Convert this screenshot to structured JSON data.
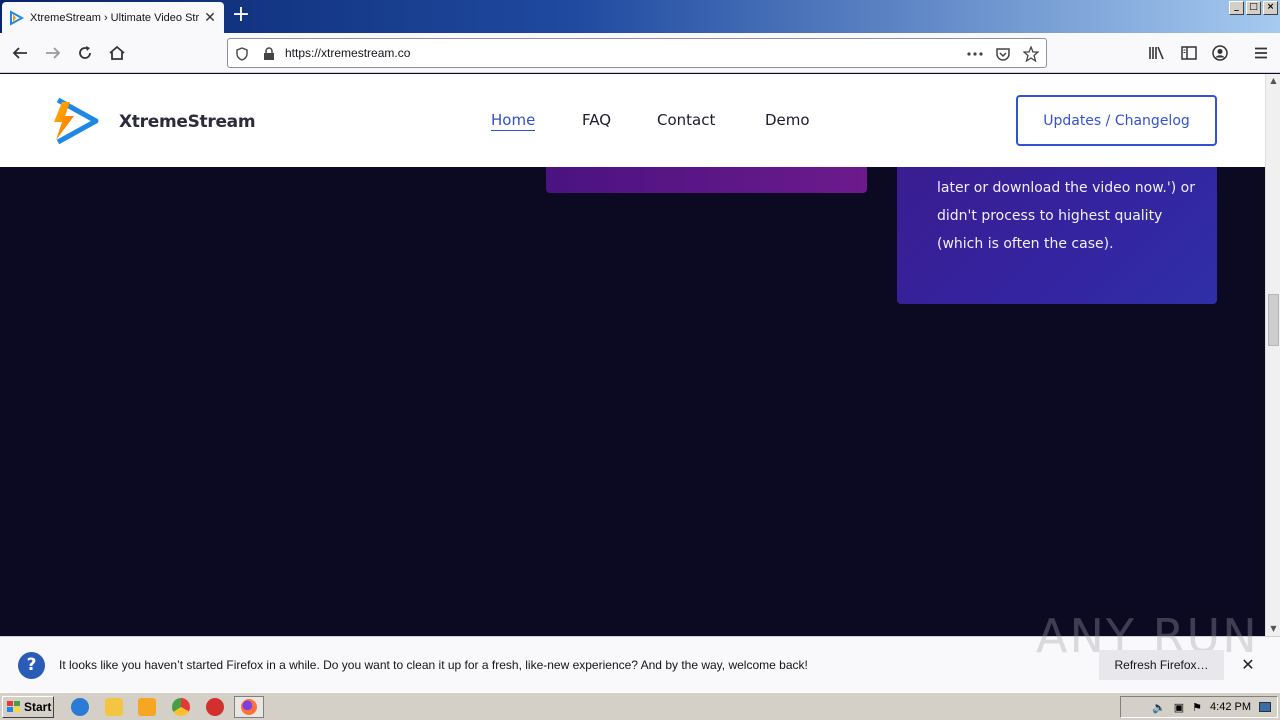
{
  "browser": {
    "tab_title": "XtremeStream › Ultimate Video Str",
    "new_tab_symbol": "+",
    "url": "https://xtremestream.co",
    "window_buttons": [
      "_",
      "□",
      "×"
    ]
  },
  "site": {
    "brand": "XtremeStream",
    "nav": [
      {
        "label": "Home",
        "active": true
      },
      {
        "label": "FAQ",
        "active": false
      },
      {
        "label": "Contact",
        "active": false
      },
      {
        "label": "Demo",
        "active": false
      }
    ],
    "changelog_button": "Updates / Changelog",
    "card_text": "later or download the video now.') or didn't process to highest quality (which is often the case).",
    "colors": {
      "accent": "#3451d1",
      "page_bg": "#0b0a22",
      "card_purple": "#6c1a8c",
      "card_blue": "#3424a0"
    }
  },
  "notification": {
    "message": "It looks like you haven’t started Firefox in a while. Do you want to clean it up for a fresh, like-new experience? And by the way, welcome back!",
    "button": "Refresh Firefox…",
    "icon": "question-icon"
  },
  "watermark": "ANY RUN",
  "taskbar": {
    "start_label": "Start",
    "clock": "4:42 PM",
    "apps": [
      "ie-icon",
      "explorer-icon",
      "media-player-icon",
      "chrome-icon",
      "opera-icon",
      "firefox-icon"
    ]
  }
}
